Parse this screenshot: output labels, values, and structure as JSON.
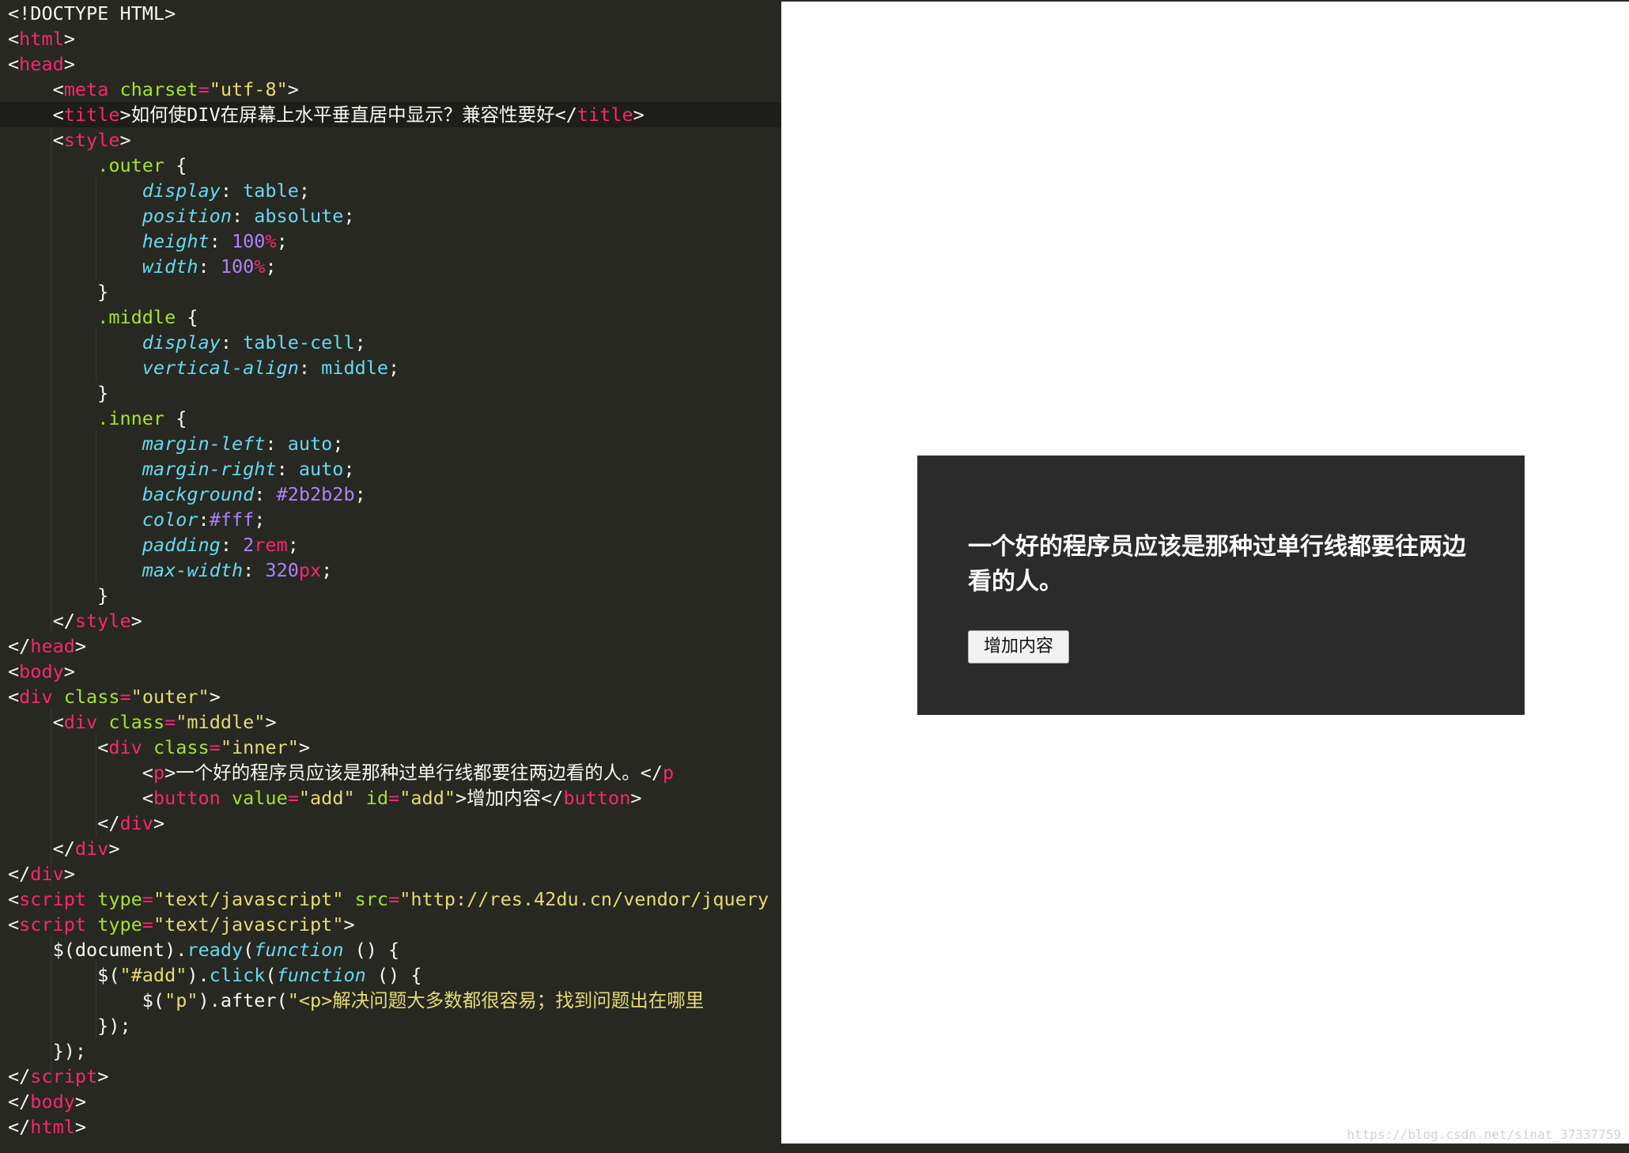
{
  "editor": {
    "current_line_index": 4,
    "lines": [
      [
        [
          "pun",
          "<!DOCTYPE HTML>"
        ]
      ],
      [
        [
          "pun",
          "<"
        ],
        [
          "tag",
          "html"
        ],
        [
          "pun",
          ">"
        ]
      ],
      [
        [
          "pun",
          "<"
        ],
        [
          "tag",
          "head"
        ],
        [
          "pun",
          ">"
        ]
      ],
      [
        [
          "pun",
          "    <"
        ],
        [
          "tag",
          "meta"
        ],
        [
          "pun",
          " "
        ],
        [
          "attr",
          "charset"
        ],
        [
          "op",
          "="
        ],
        [
          "str",
          "\"utf-8\""
        ],
        [
          "pun",
          ">"
        ]
      ],
      [
        [
          "pun",
          "    <"
        ],
        [
          "tag",
          "title"
        ],
        [
          "pun",
          ">"
        ],
        [
          "txt",
          "如何使DIV在屏幕上水平垂直居中显示？兼容性要好"
        ],
        [
          "pun",
          "</"
        ],
        [
          "tag",
          "title"
        ],
        [
          "pun",
          ">"
        ]
      ],
      [
        [
          "pun",
          "    <"
        ],
        [
          "tag",
          "style"
        ],
        [
          "pun",
          ">"
        ]
      ],
      [
        [
          "pun",
          "        "
        ],
        [
          "sel",
          ".outer"
        ],
        [
          "pun",
          " {"
        ]
      ],
      [
        [
          "pun",
          "            "
        ],
        [
          "prop",
          "display"
        ],
        [
          "pun",
          ": "
        ],
        [
          "val",
          "table"
        ],
        [
          "pun",
          ";"
        ]
      ],
      [
        [
          "pun",
          "            "
        ],
        [
          "prop",
          "position"
        ],
        [
          "pun",
          ": "
        ],
        [
          "val",
          "absolute"
        ],
        [
          "pun",
          ";"
        ]
      ],
      [
        [
          "pun",
          "            "
        ],
        [
          "prop",
          "height"
        ],
        [
          "pun",
          ": "
        ],
        [
          "num",
          "100"
        ],
        [
          "unit",
          "%"
        ],
        [
          "pun",
          ";"
        ]
      ],
      [
        [
          "pun",
          "            "
        ],
        [
          "prop",
          "width"
        ],
        [
          "pun",
          ": "
        ],
        [
          "num",
          "100"
        ],
        [
          "unit",
          "%"
        ],
        [
          "pun",
          ";"
        ]
      ],
      [
        [
          "pun",
          "        }"
        ]
      ],
      [
        [
          "pun",
          "        "
        ],
        [
          "sel",
          ".middle"
        ],
        [
          "pun",
          " {"
        ]
      ],
      [
        [
          "pun",
          "            "
        ],
        [
          "prop",
          "display"
        ],
        [
          "pun",
          ": "
        ],
        [
          "val",
          "table-cell"
        ],
        [
          "pun",
          ";"
        ]
      ],
      [
        [
          "pun",
          "            "
        ],
        [
          "prop",
          "vertical-align"
        ],
        [
          "pun",
          ": "
        ],
        [
          "val",
          "middle"
        ],
        [
          "pun",
          ";"
        ]
      ],
      [
        [
          "pun",
          "        }"
        ]
      ],
      [
        [
          "pun",
          "        "
        ],
        [
          "sel",
          ".inner"
        ],
        [
          "pun",
          " {"
        ]
      ],
      [
        [
          "pun",
          "            "
        ],
        [
          "prop",
          "margin-left"
        ],
        [
          "pun",
          ": "
        ],
        [
          "val",
          "auto"
        ],
        [
          "pun",
          ";"
        ]
      ],
      [
        [
          "pun",
          "            "
        ],
        [
          "prop",
          "margin-right"
        ],
        [
          "pun",
          ": "
        ],
        [
          "val",
          "auto"
        ],
        [
          "pun",
          ";"
        ]
      ],
      [
        [
          "pun",
          "            "
        ],
        [
          "prop",
          "background"
        ],
        [
          "pun",
          ": "
        ],
        [
          "num",
          "#2b2b2b"
        ],
        [
          "pun",
          ";"
        ]
      ],
      [
        [
          "pun",
          "            "
        ],
        [
          "prop",
          "color"
        ],
        [
          "pun",
          ":"
        ],
        [
          "num",
          "#fff"
        ],
        [
          "pun",
          ";"
        ]
      ],
      [
        [
          "pun",
          "            "
        ],
        [
          "prop",
          "padding"
        ],
        [
          "pun",
          ": "
        ],
        [
          "num",
          "2"
        ],
        [
          "unit",
          "rem"
        ],
        [
          "pun",
          ";"
        ]
      ],
      [
        [
          "pun",
          "            "
        ],
        [
          "prop",
          "max-width"
        ],
        [
          "pun",
          ": "
        ],
        [
          "num",
          "320"
        ],
        [
          "unit",
          "px"
        ],
        [
          "pun",
          ";"
        ]
      ],
      [
        [
          "pun",
          "        }"
        ]
      ],
      [
        [
          "pun",
          "    </"
        ],
        [
          "tag",
          "style"
        ],
        [
          "pun",
          ">"
        ]
      ],
      [
        [
          "pun",
          "</"
        ],
        [
          "tag",
          "head"
        ],
        [
          "pun",
          ">"
        ]
      ],
      [
        [
          "pun",
          "<"
        ],
        [
          "tag",
          "body"
        ],
        [
          "pun",
          ">"
        ]
      ],
      [
        [
          "pun",
          "<"
        ],
        [
          "tag",
          "div"
        ],
        [
          "pun",
          " "
        ],
        [
          "attr",
          "class"
        ],
        [
          "op",
          "="
        ],
        [
          "str",
          "\"outer\""
        ],
        [
          "pun",
          ">"
        ]
      ],
      [
        [
          "pun",
          "    <"
        ],
        [
          "tag",
          "div"
        ],
        [
          "pun",
          " "
        ],
        [
          "attr",
          "class"
        ],
        [
          "op",
          "="
        ],
        [
          "str",
          "\"middle\""
        ],
        [
          "pun",
          ">"
        ]
      ],
      [
        [
          "pun",
          "        <"
        ],
        [
          "tag",
          "div"
        ],
        [
          "pun",
          " "
        ],
        [
          "attr",
          "class"
        ],
        [
          "op",
          "="
        ],
        [
          "str",
          "\"inner\""
        ],
        [
          "pun",
          ">"
        ]
      ],
      [
        [
          "pun",
          "            <"
        ],
        [
          "tag",
          "p"
        ],
        [
          "pun",
          ">"
        ],
        [
          "txt",
          "一个好的程序员应该是那种过单行线都要往两边看的人。"
        ],
        [
          "pun",
          "</"
        ],
        [
          "tag",
          "p"
        ]
      ],
      [
        [
          "pun",
          "            <"
        ],
        [
          "tag",
          "button"
        ],
        [
          "pun",
          " "
        ],
        [
          "attr",
          "value"
        ],
        [
          "op",
          "="
        ],
        [
          "str",
          "\"add\""
        ],
        [
          "pun",
          " "
        ],
        [
          "attr",
          "id"
        ],
        [
          "op",
          "="
        ],
        [
          "str",
          "\"add\""
        ],
        [
          "pun",
          ">"
        ],
        [
          "txt",
          "增加内容"
        ],
        [
          "pun",
          "</"
        ],
        [
          "tag",
          "button"
        ],
        [
          "pun",
          ">"
        ]
      ],
      [
        [
          "pun",
          "        </"
        ],
        [
          "tag",
          "div"
        ],
        [
          "pun",
          ">"
        ]
      ],
      [
        [
          "pun",
          "    </"
        ],
        [
          "tag",
          "div"
        ],
        [
          "pun",
          ">"
        ]
      ],
      [
        [
          "pun",
          "</"
        ],
        [
          "tag",
          "div"
        ],
        [
          "pun",
          ">"
        ]
      ],
      [
        [
          "pun",
          "<"
        ],
        [
          "tag",
          "script"
        ],
        [
          "pun",
          " "
        ],
        [
          "attr",
          "type"
        ],
        [
          "op",
          "="
        ],
        [
          "str",
          "\"text/javascript\""
        ],
        [
          "pun",
          " "
        ],
        [
          "attr",
          "src"
        ],
        [
          "op",
          "="
        ],
        [
          "str",
          "\"http://res.42du.cn/vendor/jquery"
        ]
      ],
      [
        [
          "pun",
          "<"
        ],
        [
          "tag",
          "script"
        ],
        [
          "pun",
          " "
        ],
        [
          "attr",
          "type"
        ],
        [
          "op",
          "="
        ],
        [
          "str",
          "\"text/javascript\""
        ],
        [
          "pun",
          ">"
        ]
      ],
      [
        [
          "pun",
          "    $("
        ],
        [
          "txt",
          "document"
        ],
        [
          "pun",
          ")."
        ],
        [
          "fn",
          "ready"
        ],
        [
          "pun",
          "("
        ],
        [
          "kw",
          "function"
        ],
        [
          "pun",
          " () {"
        ]
      ],
      [
        [
          "pun",
          "        $("
        ],
        [
          "str",
          "\"#add\""
        ],
        [
          "pun",
          ")."
        ],
        [
          "fn",
          "click"
        ],
        [
          "pun",
          "("
        ],
        [
          "kw",
          "function"
        ],
        [
          "pun",
          " () {"
        ]
      ],
      [
        [
          "pun",
          "            $("
        ],
        [
          "str",
          "\"p\""
        ],
        [
          "pun",
          ").after("
        ],
        [
          "str",
          "\"<p>解决问题大多数都很容易；找到问题出在哪里"
        ]
      ],
      [
        [
          "pun",
          "        });"
        ]
      ],
      [
        [
          "pun",
          "    });"
        ]
      ],
      [
        [
          "pun",
          "</"
        ],
        [
          "tag",
          "script"
        ],
        [
          "pun",
          ">"
        ]
      ],
      [
        [
          "pun",
          "</"
        ],
        [
          "tag",
          "body"
        ],
        [
          "pun",
          ">"
        ]
      ],
      [
        [
          "pun",
          "</"
        ],
        [
          "tag",
          "html"
        ],
        [
          "pun",
          ">"
        ]
      ]
    ]
  },
  "preview": {
    "paragraph": "一个好的程序员应该是那种过单行线都要往两边看的人。",
    "button_label": "增加内容",
    "button_value": "add",
    "watermark": "https://blog.csdn.net/sinat_37337759"
  },
  "theme": {
    "editor_bg": "#272822",
    "tag": "#f92672",
    "attr": "#a6e22e",
    "string": "#e6db74",
    "property": "#66d9ef",
    "number": "#ae81ff",
    "inner_bg": "#2b2b2b",
    "inner_text": "#fff"
  }
}
